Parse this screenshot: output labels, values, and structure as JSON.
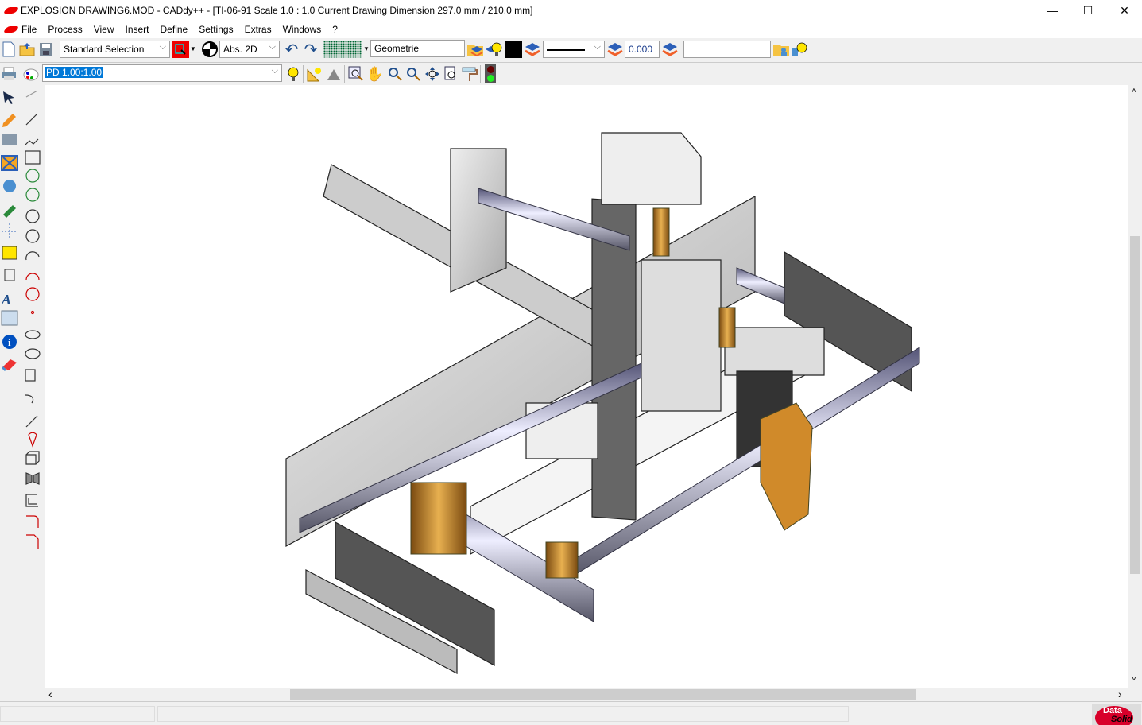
{
  "window": {
    "title": "EXPLOSION DRAWING6.MOD  -  CADdy++  - [TI-06-91   Scale 1.0 : 1.0   Current Drawing Dimension 297.0 mm / 210.0 mm]",
    "minimize": "—",
    "maximize": "☐",
    "close": "✕"
  },
  "menu": [
    "File",
    "Process",
    "View",
    "Insert",
    "Define",
    "Settings",
    "Extras",
    "Windows",
    "?"
  ],
  "mdi": {
    "minimize": "_",
    "restore": "❐",
    "close": "✕"
  },
  "toolbar1": {
    "selection_mode": "Standard Selection",
    "coord_mode": "Abs. 2D",
    "layer": "Geometrie",
    "line_width": "0.000",
    "text_field": "",
    "color": "#000000"
  },
  "toolbar2": {
    "view_scale": "PD 1.00:1.00"
  },
  "scroll": {
    "left": "‹",
    "right": "›",
    "up": "˄",
    "down": "˅"
  },
  "brand": {
    "line1": "Data",
    "line2": "Solid"
  },
  "colors": {
    "accent": "#e00000",
    "selection": "#0078d7"
  }
}
